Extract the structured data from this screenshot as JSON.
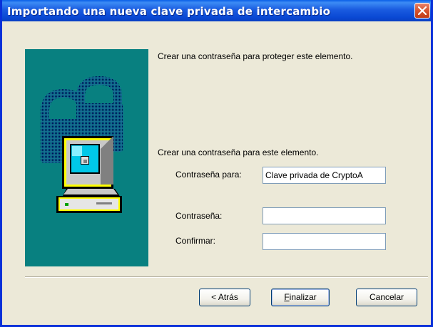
{
  "window": {
    "title": "Importando una nueva clave privada de intercambio"
  },
  "intro_text": "Crear una contraseña para proteger este elemento.",
  "section_text": "Crear una contraseña para este elemento.",
  "form": {
    "purpose_label": "Contraseña para:",
    "purpose_value": "Clave privada de CryptoA",
    "password_label": "Contraseña:",
    "password_value": "",
    "confirm_label": "Confirmar:",
    "confirm_value": ""
  },
  "buttons": {
    "back_label": "< Atrás",
    "finish_mnemonic": "F",
    "finish_rest": "inalizar",
    "cancel_label": "Cancelar"
  },
  "icons": [
    "close-icon",
    "padlock-icon",
    "computer-icon"
  ],
  "colors": {
    "titlebar": "#0A49D4",
    "panel": "#088080",
    "window_bg": "#ECE9D8"
  }
}
